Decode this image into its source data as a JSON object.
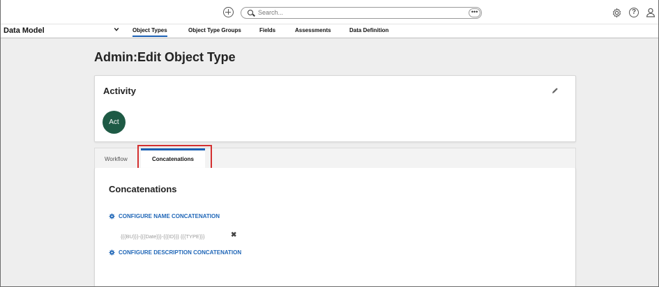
{
  "topbar": {
    "search_placeholder": "Search...",
    "more_label": "•••"
  },
  "nav": {
    "title": "Data Model",
    "tabs": [
      {
        "label": "Object Types",
        "active": true
      },
      {
        "label": "Object Type Groups",
        "active": false
      },
      {
        "label": "Fields",
        "active": false
      },
      {
        "label": "Assessments",
        "active": false
      },
      {
        "label": "Data Definition",
        "active": false
      }
    ]
  },
  "page": {
    "title": "Admin:Edit Object Type"
  },
  "activity": {
    "title": "Activity",
    "avatar_text": "Act",
    "avatar_color": "#1e5a45"
  },
  "detail_tabs": [
    {
      "label": "Workflow",
      "active": false
    },
    {
      "label": "Concatenations",
      "active": true
    }
  ],
  "concatenations": {
    "title": "Concatenations",
    "configure_name": "CONFIGURE NAME CONCATENATION",
    "formula": "{{{BU}}}-{{{Date}}}-{{{ID}}} {{{TYPE}}}",
    "remove_symbol": "✖",
    "configure_description": "CONFIGURE DESCRIPTION CONCATENATION"
  },
  "colors": {
    "accent": "#1a5fb4",
    "link": "#1f66b7",
    "highlight": "#d32f2f"
  }
}
